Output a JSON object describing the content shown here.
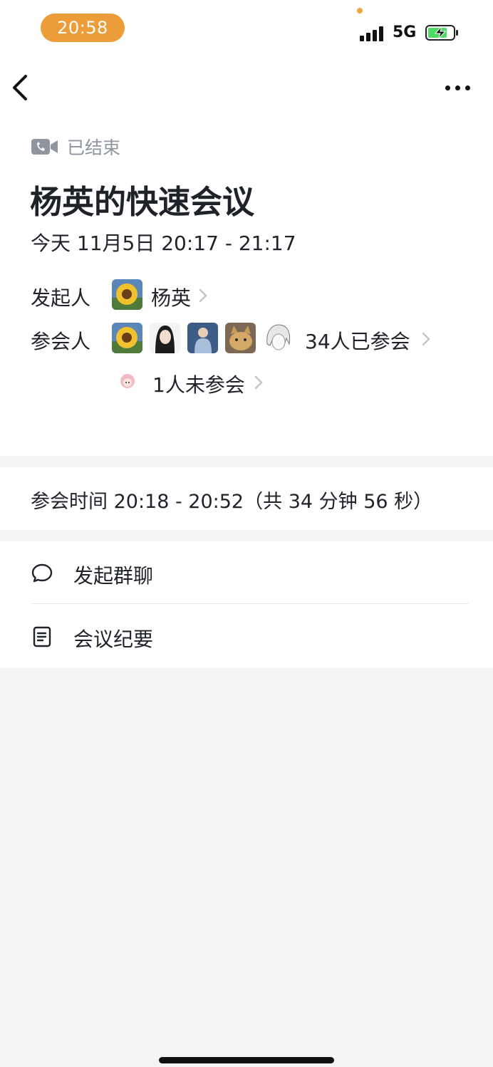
{
  "status_bar": {
    "time": "20:58",
    "network": "5G"
  },
  "meeting": {
    "status": "已结束",
    "title": "杨英的快速会议",
    "date_time": "今天 11月5日 20:17 - 21:17"
  },
  "initiator": {
    "label": "发起人",
    "name": "杨英"
  },
  "participants": {
    "label": "参会人",
    "joined_text": "34人已参会",
    "not_joined_text": "1人未参会"
  },
  "attendance": {
    "text": "参会时间   20:18 - 20:52（共 34 分钟 56 秒）"
  },
  "actions": [
    {
      "label": "发起群聊",
      "icon": "chat-bubble-icon"
    },
    {
      "label": "会议纪要",
      "icon": "document-icon"
    }
  ],
  "colors": {
    "time_pill": "#ed9c3a",
    "muted": "#8f959e",
    "battery_fill": "#4cd964"
  }
}
